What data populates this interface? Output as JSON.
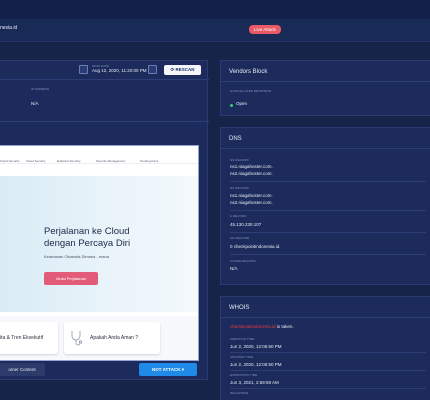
{
  "header": {
    "site_name": "nesia.id",
    "live_badge": "Live Attack"
  },
  "scan": {
    "date_label": "SCAN DATE",
    "date_value": "Aug 12, 2020, 11:20:00 PM",
    "rescan_label": "RESCAN",
    "ip_label": "IP ADDRESS",
    "ip_value": "N/A"
  },
  "preview": {
    "nav_items": [
      "Cloud Security",
      "Cloud Security",
      "Endpoint Security",
      "Security Management",
      "Tentang Kami"
    ],
    "hero_title_line1": "Perjalanan ke Cloud",
    "hero_title_line2": "dengan Percaya Diri",
    "hero_subtitle": "Keamanan Otomatis Dimana - mana",
    "hero_cta": "Mulai Perjalanan",
    "card1_text": "ita & Tren Eksekutif",
    "card2_text": "Apakah Anda Aman ?"
  },
  "actions": {
    "customer_content": "omer Content",
    "not_attack": "NOT ATTACK"
  },
  "vendors": {
    "title": "Vendors Block",
    "field_label": "GOOGLE SAFE BROWSING",
    "status": "Open"
  },
  "dns": {
    "title": "DNS",
    "ns_label": "NS RECORD",
    "ns_values": [
      "ns1.niagahoster.com.",
      "ns2.niagahoster.com."
    ],
    "ns2_label": "NS RECORD",
    "ns2_values": [
      "ns1.niagahoster.com.",
      "ns2.niagahoster.com."
    ],
    "a_label": "A RECORD",
    "a_value": "45.130.230.107",
    "mx_label": "MX RECORD",
    "mx_value": "0 checkpointindonesia.id.",
    "cname_label": "CNAME RECORD",
    "cname_value": "N/A"
  },
  "whois": {
    "title": "WHOIS",
    "domain": "checkpointindonesia.id",
    "taken_suffix": "is taken.",
    "creation_label": "CREATION TIME",
    "creation_value": "Jun 2, 2020, 12:06:50 PM",
    "updated_label": "UPDATED TIME",
    "updated_value": "Jun 2, 2020, 12:06:50 PM",
    "expiration_label": "EXPIRATION TIME",
    "expiration_value": "Jun 3, 2021, 2:59:59 AM",
    "registrar_label": "REGISTRAR"
  }
}
